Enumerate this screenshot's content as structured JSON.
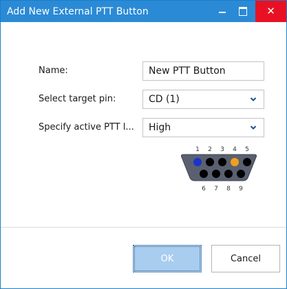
{
  "window": {
    "title": "Add New External PTT Button",
    "minimize_icon": "minimize-icon",
    "maximize_icon": "maximize-icon",
    "close_icon": "close-icon",
    "close_glyph": "✕"
  },
  "form": {
    "name_label": "Name:",
    "name_value": "New PTT Button",
    "target_pin_label": "Select target pin:",
    "target_pin_value": "CD (1)",
    "active_level_label": "Specify active PTT l...",
    "active_level_value": "High"
  },
  "connector": {
    "top_pins": [
      "1",
      "2",
      "3",
      "4",
      "5"
    ],
    "bottom_pins": [
      "6",
      "7",
      "8",
      "9"
    ],
    "highlight_colors": {
      "pin_1": "#1a33cc",
      "pin_4": "#f0a020"
    }
  },
  "buttons": {
    "ok_label": "OK",
    "cancel_label": "Cancel"
  },
  "colors": {
    "titlebar": "#2b8ad6",
    "close_button": "#e81123",
    "ok_button": "#a9cdef",
    "connector_body": "#5a6070"
  }
}
